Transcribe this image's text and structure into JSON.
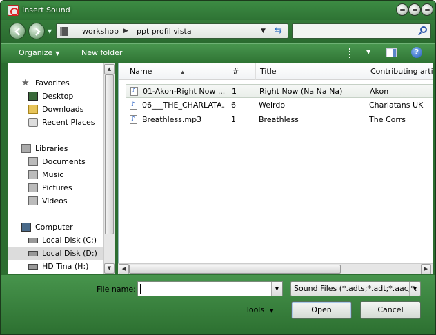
{
  "window": {
    "title": "Insert Sound"
  },
  "address": {
    "parts": [
      "workshop",
      "ppt profil vista"
    ],
    "separator": "▶",
    "search_placeholder": ""
  },
  "toolbar": {
    "organize": "Organize",
    "new_folder": "New folder",
    "help": "?"
  },
  "sidebar": {
    "favorites": {
      "label": "Favorites",
      "items": [
        "Desktop",
        "Downloads",
        "Recent Places"
      ]
    },
    "libraries": {
      "label": "Libraries",
      "items": [
        "Documents",
        "Music",
        "Pictures",
        "Videos"
      ]
    },
    "computer": {
      "label": "Computer",
      "items": [
        "Local Disk (C:)",
        "Local Disk (D:)",
        "HD Tina (H:)"
      ],
      "selected": "Local Disk (D:)"
    }
  },
  "columns": {
    "name": "Name",
    "num": "#",
    "title": "Title",
    "artist": "Contributing artis"
  },
  "files": [
    {
      "name": "01-Akon-Right Now ...",
      "num": "1",
      "title": "Right Now (Na Na Na)",
      "artist": "Akon"
    },
    {
      "name": "06___THE_CHARLATA...",
      "num": "6",
      "title": "Weirdo",
      "artist": "Charlatans UK"
    },
    {
      "name": "Breathless.mp3",
      "num": "1",
      "title": "Breathless",
      "artist": "The Corrs"
    }
  ],
  "footer": {
    "file_name_label": "File name:",
    "file_name_value": "",
    "file_type": "Sound Files (*.adts;*.adt;*.aac;*.",
    "tools": "Tools",
    "open": "Open",
    "cancel": "Cancel"
  },
  "icons": {
    "back": "back-arrow-icon",
    "forward": "forward-arrow-icon",
    "refresh": "refresh-icon",
    "search": "search-icon"
  },
  "colors": {
    "chrome_green": "#2e7334",
    "selection": "#dcdcdc"
  }
}
